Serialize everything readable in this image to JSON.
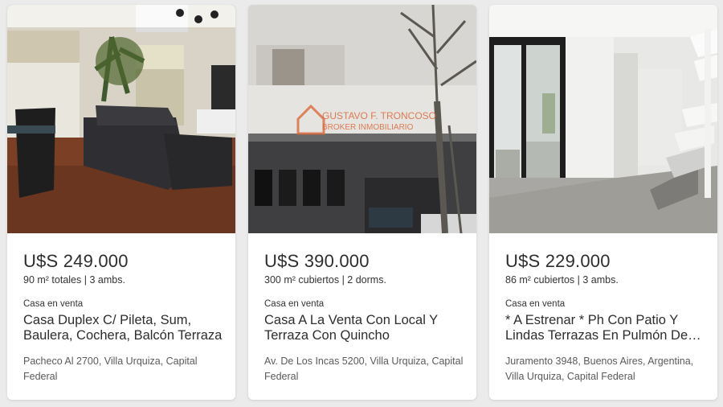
{
  "listings": [
    {
      "price": "U$S 249.000",
      "features": "90 m² totales | 3 ambs.",
      "type": "Casa en venta",
      "title": "Casa Duplex C/ Pileta, Sum, Baulera, Cochera, Balcón Terraza",
      "address": "Pacheco Al 2700, Villa Urquiza, Capital Federal",
      "image": "living-room-photo"
    },
    {
      "price": "U$S 390.000",
      "features": "300 m² cubiertos | 2 dorms.",
      "type": "Casa en venta",
      "title": "Casa A La Venta Con Local Y Terraza Con Quincho",
      "address": "Av. De Los Incas 5200, Villa Urquiza, Capital Federal",
      "image": "building-facade-photo",
      "watermark_line1": "GUSTAVO F. TRONCOSO",
      "watermark_line2": "BROKER INMOBILIARIO"
    },
    {
      "price": "U$S 229.000",
      "features": "86 m² cubiertos | 3 ambs.",
      "type": "Casa en venta",
      "title": "* A Estrenar * Ph Con Patio Y Lindas Terrazas En Pulmón De Manzana",
      "address": "Juramento 3948, Buenos Aires, Argentina, Villa Urquiza, Capital Federal",
      "image": "interior-stairs-photo"
    }
  ]
}
